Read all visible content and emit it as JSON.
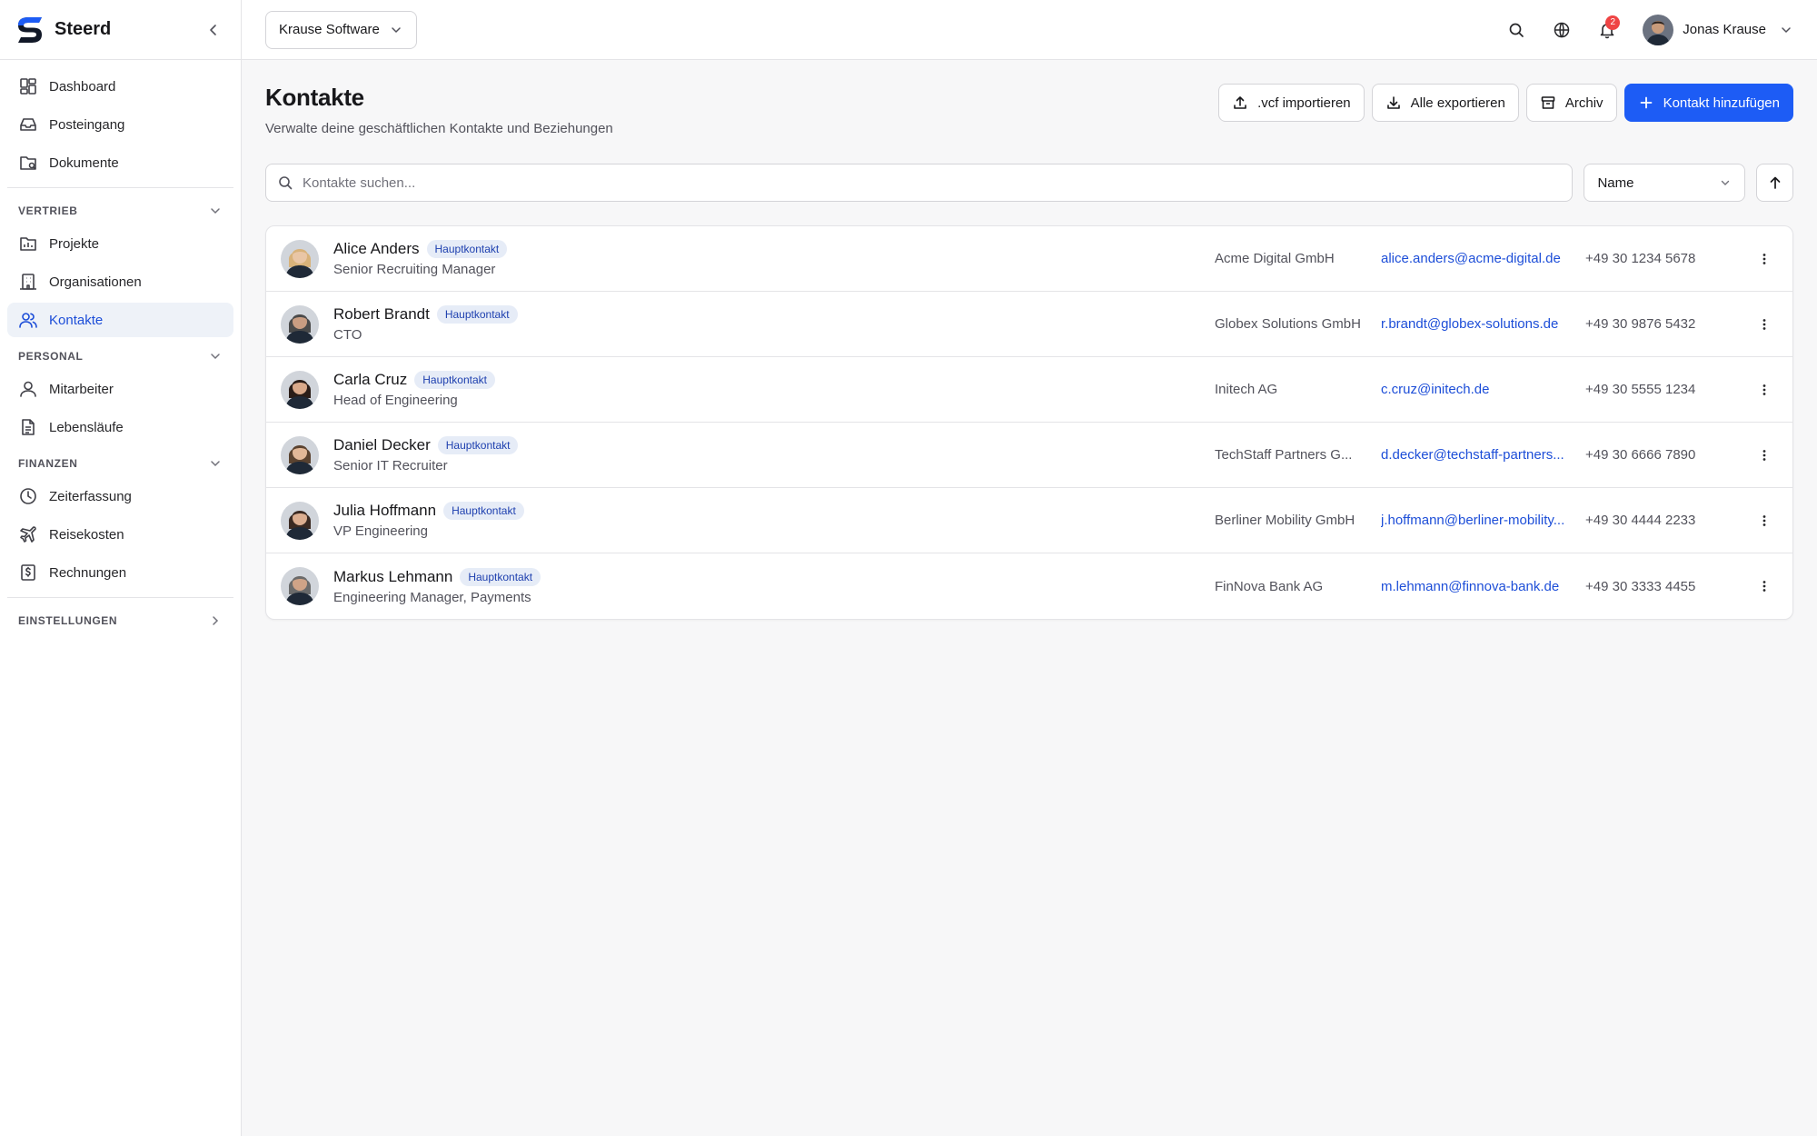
{
  "app": {
    "name": "Steerd"
  },
  "sidebar": {
    "top_items": [
      {
        "label": "Dashboard",
        "icon": "dashboard-icon"
      },
      {
        "label": "Posteingang",
        "icon": "inbox-icon"
      },
      {
        "label": "Dokumente",
        "icon": "documents-icon"
      }
    ],
    "sections": [
      {
        "title": "VERTRIEB",
        "items": [
          {
            "label": "Projekte",
            "icon": "projects-icon"
          },
          {
            "label": "Organisationen",
            "icon": "building-icon"
          },
          {
            "label": "Kontakte",
            "icon": "users-icon",
            "active": true
          }
        ]
      },
      {
        "title": "PERSONAL",
        "items": [
          {
            "label": "Mitarbeiter",
            "icon": "user-icon"
          },
          {
            "label": "Lebensläufe",
            "icon": "file-text-icon"
          }
        ]
      },
      {
        "title": "FINANZEN",
        "items": [
          {
            "label": "Zeiterfassung",
            "icon": "clock-icon"
          },
          {
            "label": "Reisekosten",
            "icon": "plane-icon"
          },
          {
            "label": "Rechnungen",
            "icon": "invoice-icon"
          }
        ]
      }
    ],
    "settings": {
      "title": "EINSTELLUNGEN"
    }
  },
  "topbar": {
    "workspace": "Krause Software",
    "notifications_count": "2",
    "user_name": "Jonas Krause"
  },
  "page": {
    "title": "Kontakte",
    "subtitle": "Verwalte deine geschäftlichen Kontakte und Beziehungen",
    "actions": {
      "import": ".vcf importieren",
      "export": "Alle exportieren",
      "archive": "Archiv",
      "add": "Kontakt hinzufügen"
    },
    "search_placeholder": "Kontakte suchen...",
    "sort_value": "Name"
  },
  "contacts": [
    {
      "name": "Alice Anders",
      "tag": "Hauptkontakt",
      "role": "Senior Recruiting Manager",
      "org": "Acme Digital GmbH",
      "email": "alice.anders@acme-digital.de",
      "phone": "+49 30 1234 5678",
      "skin": "#e9c6a6",
      "hair": "#d8b27a"
    },
    {
      "name": "Robert Brandt",
      "tag": "Hauptkontakt",
      "role": "CTO",
      "org": "Globex Solutions GmbH",
      "email": "r.brandt@globex-solutions.de",
      "phone": "+49 30 9876 5432",
      "skin": "#c99d82",
      "hair": "#4a4a4a"
    },
    {
      "name": "Carla Cruz",
      "tag": "Hauptkontakt",
      "role": "Head of Engineering",
      "org": "Initech AG",
      "email": "c.cruz@initech.de",
      "phone": "+49 30 5555 1234",
      "skin": "#d9a98a",
      "hair": "#2a1d18"
    },
    {
      "name": "Daniel Decker",
      "tag": "Hauptkontakt",
      "role": "Senior IT Recruiter",
      "org": "TechStaff Partners G...",
      "email": "d.decker@techstaff-partners...",
      "phone": "+49 30 6666 7890",
      "skin": "#e2b898",
      "hair": "#5b4330"
    },
    {
      "name": "Julia Hoffmann",
      "tag": "Hauptkontakt",
      "role": "VP Engineering",
      "org": "Berliner Mobility GmbH",
      "email": "j.hoffmann@berliner-mobility...",
      "phone": "+49 30 4444 2233",
      "skin": "#dcae90",
      "hair": "#3b2a22"
    },
    {
      "name": "Markus Lehmann",
      "tag": "Hauptkontakt",
      "role": "Engineering Manager, Payments",
      "org": "FinNova Bank AG",
      "email": "m.lehmann@finnova-bank.de",
      "phone": "+49 30 3333 4455",
      "skin": "#cfa387",
      "hair": "#6b6b6b"
    }
  ],
  "colors": {
    "accent": "#1d5cf5",
    "active_bg": "#eef2f8",
    "badge": "#ef4444",
    "link": "#1d4ed8"
  }
}
